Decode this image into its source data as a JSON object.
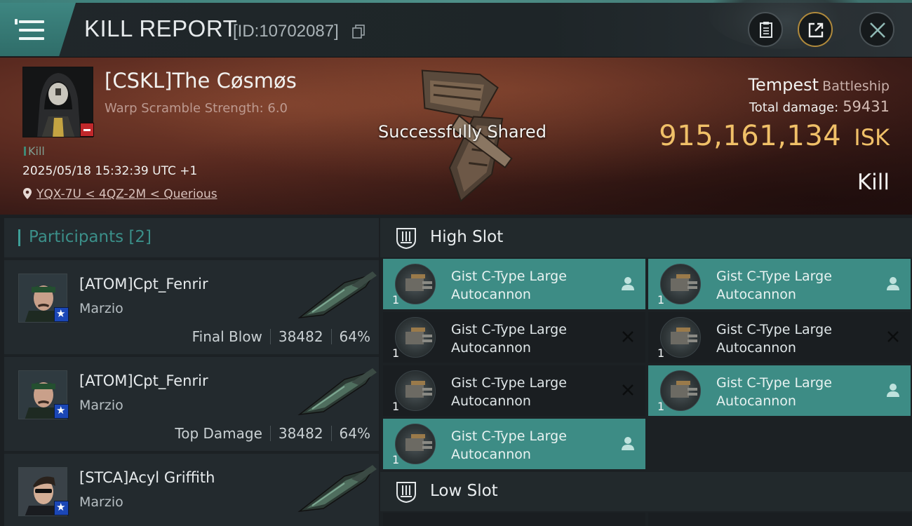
{
  "header": {
    "title": "KILL REPORT",
    "report_id": "[ID:10702087]"
  },
  "victim": {
    "name": "[CSKL]The Cøsmøs",
    "subtitle": "Warp Scramble Strength: 6.0",
    "tag": "Kill",
    "datetime": "2025/05/18 15:32:39 UTC +1",
    "location": "YQX-7U < 4QZ-2M < Querious"
  },
  "toast": "Successfully Shared",
  "ship": {
    "name": "Tempest",
    "class": "Battleship",
    "total_damage_label": "Total damage:",
    "total_damage": "59431",
    "isk_value": "915,161,134",
    "isk_unit": "ISK",
    "result": "Kill"
  },
  "participants": {
    "title": "Participants",
    "count": "[2]",
    "items": [
      {
        "name": "[ATOM]Cpt_Fenrir",
        "corp": "Marzio",
        "role": "Final Blow",
        "damage": "38482",
        "percent": "64%"
      },
      {
        "name": "[ATOM]Cpt_Fenrir",
        "corp": "Marzio",
        "role": "Top Damage",
        "damage": "38482",
        "percent": "64%"
      },
      {
        "name": "[STCA]Acyl Griffith",
        "corp": "Marzio"
      }
    ]
  },
  "slots": {
    "high_slot_title": "High Slot",
    "low_slot_title": "Low Slot",
    "modules": [
      {
        "qty": "1",
        "line1": "Gist C-Type Large",
        "line2": "Autocannon",
        "status": "dropped"
      },
      {
        "qty": "1",
        "line1": "Gist C-Type Large",
        "line2": "Autocannon",
        "status": "dropped"
      },
      {
        "qty": "1",
        "line1": "Gist C-Type Large",
        "line2": "Autocannon",
        "status": "destroyed"
      },
      {
        "qty": "1",
        "line1": "Gist C-Type Large",
        "line2": "Autocannon",
        "status": "destroyed"
      },
      {
        "qty": "1",
        "line1": "Gist C-Type Large",
        "line2": "Autocannon",
        "status": "destroyed"
      },
      {
        "qty": "1",
        "line1": "Gist C-Type Large",
        "line2": "Autocannon",
        "status": "dropped"
      },
      {
        "qty": "1",
        "line1": "Gist C-Type Large",
        "line2": "Autocannon",
        "status": "dropped"
      }
    ]
  },
  "colors": {
    "accent": "#3d8c85",
    "isk": "#f0c068",
    "badge_red": "#c0282b",
    "badge_blue": "#1b47b7"
  },
  "icons": [
    "menu-icon",
    "copy-icon",
    "clipboard-icon",
    "share-icon",
    "close-icon",
    "location-pin-icon",
    "high-slot-icon",
    "low-slot-icon",
    "pilot-icon",
    "destroyed-x-icon"
  ]
}
